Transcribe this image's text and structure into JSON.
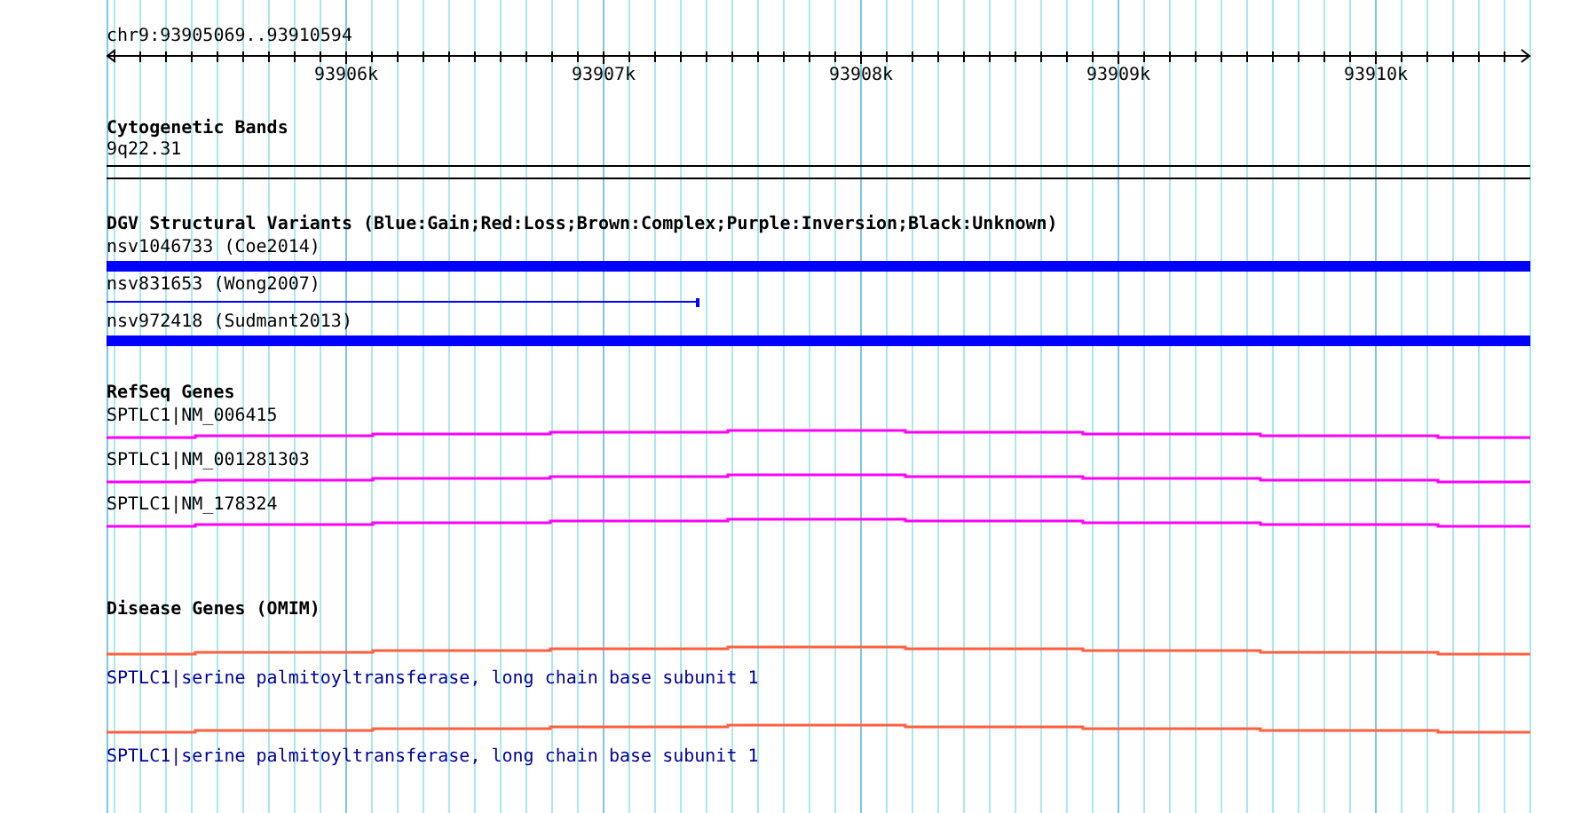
{
  "location": "chr9:93905069..93910594",
  "ruler": {
    "ticks": [
      "93906k",
      "93907k",
      "93908k",
      "93909k",
      "93910k"
    ]
  },
  "tracks": [
    {
      "title": "Cytogenetic Bands",
      "kind": "cytoband",
      "features": [
        {
          "label": "9q22.31"
        }
      ]
    },
    {
      "title": "DGV Structural Variants (Blue:Gain;Red:Loss;Brown:Complex;Purple:Inversion;Black:Unknown)",
      "kind": "variant",
      "features": [
        {
          "label": "nsv1046733 (Coe2014)",
          "kind": "bar",
          "color": "#0000ff"
        },
        {
          "label": "nsv831653 (Wong2007)",
          "kind": "line",
          "color": "#0000ff"
        },
        {
          "label": "nsv972418 (Sudmant2013)",
          "kind": "bar",
          "color": "#0000ff"
        }
      ]
    },
    {
      "title": "RefSeq Genes",
      "kind": "gene",
      "features": [
        {
          "label": "SPTLC1|NM_006415"
        },
        {
          "label": "SPTLC1|NM_001281303"
        },
        {
          "label": "SPTLC1|NM_178324"
        }
      ]
    },
    {
      "title": "Disease Genes (OMIM)",
      "kind": "omim",
      "features": [
        {
          "label": "SPTLC1|serine palmitoyltransferase, long chain base subunit 1"
        },
        {
          "label": "SPTLC1|serine palmitoyltransferase, long chain base subunit 1"
        }
      ]
    }
  ]
}
